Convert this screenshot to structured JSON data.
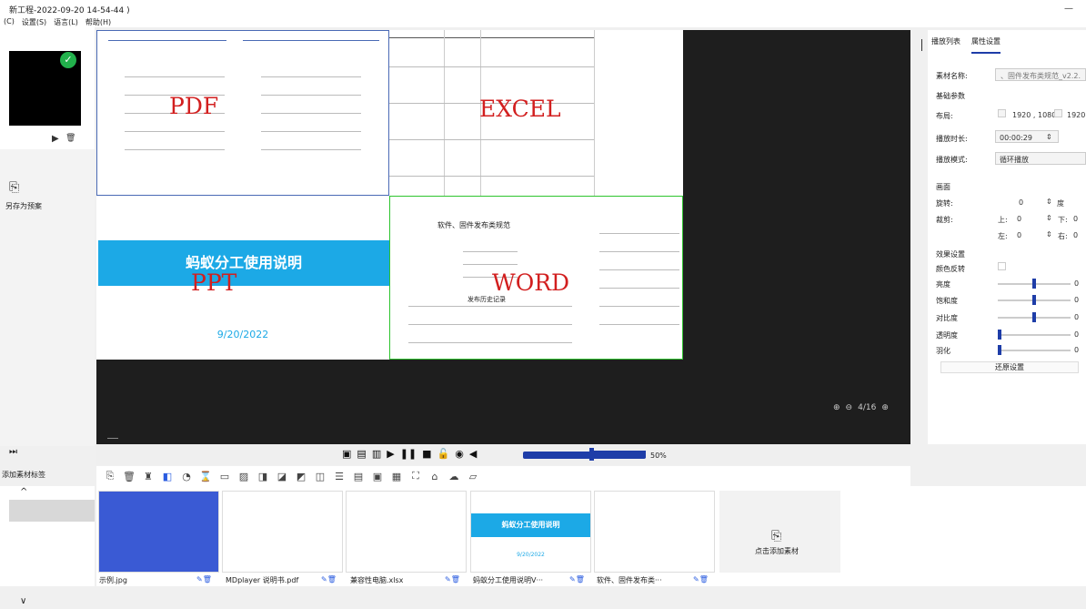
{
  "window": {
    "title": "新工程-2022-09-20 14-54-44 )",
    "menu": [
      "(C)",
      "设置(S)",
      "语言(L)",
      "帮助(H)"
    ],
    "minimize": "—"
  },
  "left": {
    "play_icon": "▶",
    "delete_icon": "🗑",
    "save_as_label": "另存为预案",
    "add_tag_label": "添加素材标签",
    "chev_up": "^",
    "chev_down": "∨",
    "toolicon": "⏭"
  },
  "stage": {
    "labels": {
      "pdf": "PDF",
      "excel": "EXCEL",
      "ppt": "PPT",
      "word": "WORD"
    },
    "ppt_title": "蚂蚁分工使用说明",
    "ppt_date": "9/20/2022",
    "word_title": "软件、固件发布类规范",
    "word_sub": "发布历史记录",
    "zoom_page": "4/16"
  },
  "playbar": {
    "volume_percent": "50%",
    "volume_level": 0.5
  },
  "toolbar": {
    "count": 18
  },
  "materials": [
    {
      "name": "示例.jpg"
    },
    {
      "name": "MDplayer 说明书.pdf"
    },
    {
      "name": "兼容性电脑.xlsx"
    },
    {
      "name": "蚂蚁分工使用说明V···"
    },
    {
      "name": "软件、固件发布类···"
    }
  ],
  "material_thumb_ppt": {
    "title": "蚂蚁分工使用说明",
    "date": "9/20/2022"
  },
  "add_material_label": "点击添加素材",
  "right": {
    "tabs": [
      "播放列表",
      "属性设置"
    ],
    "active_tab": 1,
    "material_name_label": "素材名称:",
    "material_name_value": "、固件发布类规范_v2.2.",
    "basic_params": "基础参数",
    "layout_label": "布局:",
    "layout_w": "1920 , 1080",
    "layout_w2": "1920",
    "duration_label": "播放时长:",
    "duration_value": "00:00:29",
    "mode_label": "播放模式:",
    "mode_value": "循环播放",
    "canvas": "画面",
    "rotate_label": "旋转:",
    "rotate_value": "0",
    "rotate_unit": "度",
    "crop_label": "裁剪:",
    "crop_top": "上:",
    "crop_top_value": "0",
    "crop_down": "下:",
    "crop_down_value": "0",
    "crop_left": "左:",
    "crop_left_value": "0",
    "crop_right": "右:",
    "crop_right_value": "0",
    "effect": "效果设置",
    "invert_label": "颜色反转",
    "brightness_label": "亮度",
    "saturation_label": "饱和度",
    "contrast_label": "对比度",
    "opacity_label": "透明度",
    "feather_label": "羽化",
    "slider_value": "0",
    "reset_label": "还原设置"
  }
}
